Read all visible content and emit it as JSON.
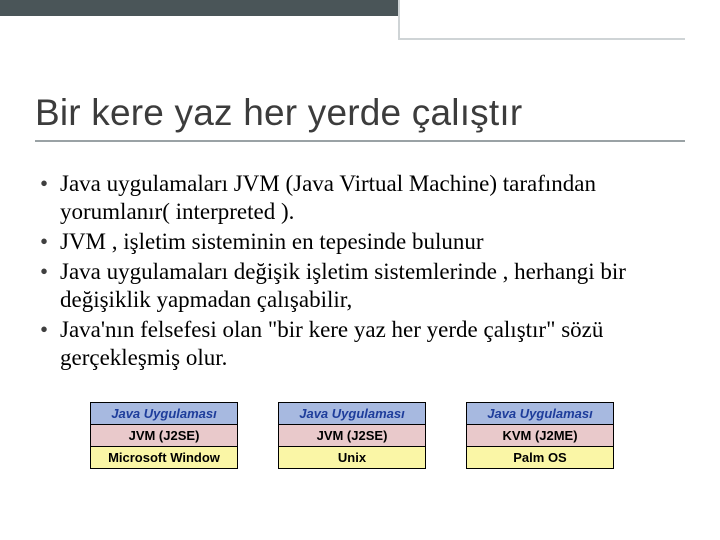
{
  "title": "Bir kere yaz her yerde çalıştır",
  "bullets": [
    "Java uygulamaları JVM (Java Virtual Machine) tarafından yorumlanır( interpreted ).",
    "JVM , işletim sisteminin en tepesinde bulunur",
    "Java uygulamaları değişik işletim sistemlerinde , herhangi bir değişiklik yapmadan çalışabilir,",
    "Java'nın felsefesi olan \"bir kere yaz her yerde çalıştır\" sözü gerçekleşmiş olur."
  ],
  "diagram": {
    "stacks": [
      {
        "app": "Java Uygulaması",
        "vm": "JVM (J2SE)",
        "os": "Microsoft Window"
      },
      {
        "app": "Java Uygulaması",
        "vm": "JVM (J2SE)",
        "os": "Unix"
      },
      {
        "app": "Java Uygulaması",
        "vm": "KVM (J2ME)",
        "os": "Palm OS"
      }
    ]
  }
}
